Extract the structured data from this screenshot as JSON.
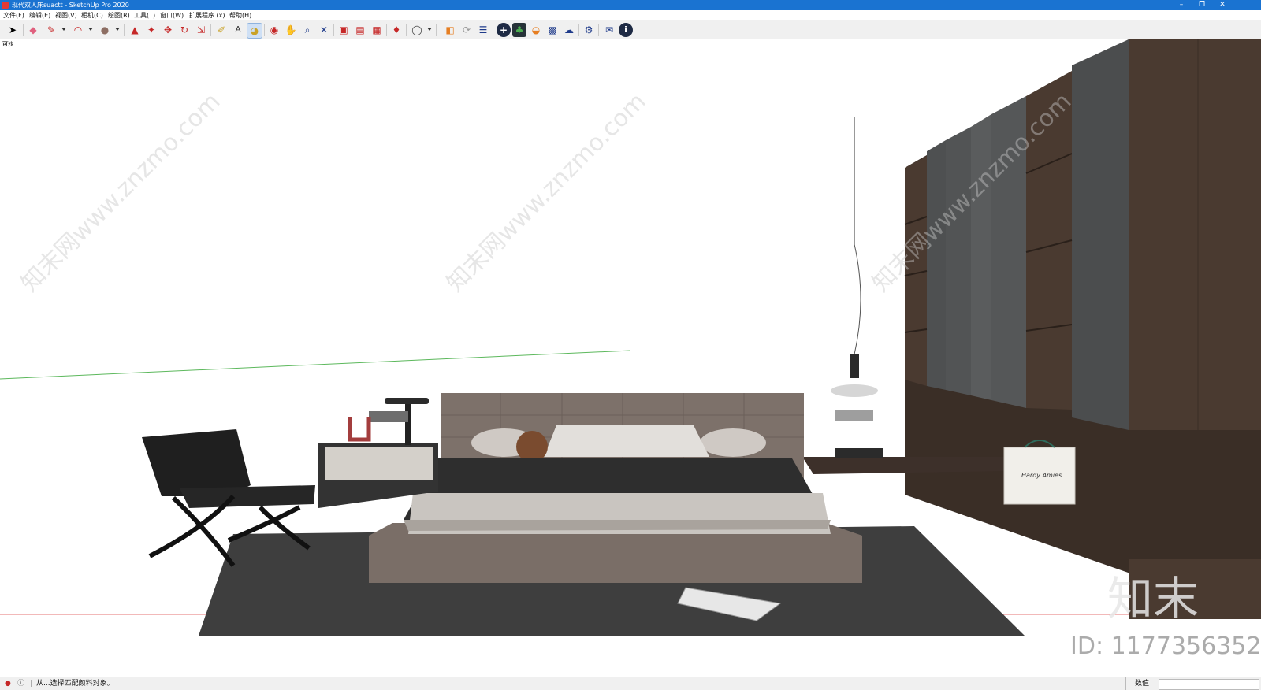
{
  "window": {
    "title": "现代双人床suactt - SketchUp Pro 2020",
    "controls": [
      "–",
      "❐",
      "✕"
    ]
  },
  "menu": [
    "文件(F)",
    "编辑(E)",
    "视图(V)",
    "相机(C)",
    "绘图(R)",
    "工具(T)",
    "窗口(W)",
    "扩展程序 (x)",
    "帮助(H)"
  ],
  "toolbar": {
    "tools": [
      {
        "name": "select-tool-icon",
        "glyph": "➤",
        "color": "#111"
      },
      {
        "name": "eraser-tool-icon",
        "glyph": "◆",
        "color": "#e0607e"
      },
      {
        "name": "line-tool-icon",
        "glyph": "✎",
        "color": "#c62828"
      },
      {
        "name": "arc-tool-icon",
        "glyph": "◠",
        "color": "#c62828"
      },
      {
        "name": "shapes-tool-icon",
        "glyph": "●",
        "color": "#8d6e63"
      },
      {
        "name": "push-pull-icon",
        "glyph": "▲",
        "color": "#c62828"
      },
      {
        "name": "follow-me-icon",
        "glyph": "✦",
        "color": "#c62828"
      },
      {
        "name": "move-tool-icon",
        "glyph": "✥",
        "color": "#c62828"
      },
      {
        "name": "rotate-tool-icon",
        "glyph": "↻",
        "color": "#c62828"
      },
      {
        "name": "scale-tool-icon",
        "glyph": "⇲",
        "color": "#c62828"
      },
      {
        "name": "tape-measure-icon",
        "glyph": "✐",
        "color": "#c9a227"
      },
      {
        "name": "text-tool-icon",
        "glyph": "A",
        "color": "#333"
      },
      {
        "name": "paint-bucket-icon",
        "glyph": "◕",
        "color": "#c9a227"
      },
      {
        "name": "orbit-tool-icon",
        "glyph": "◉",
        "color": "#c62828"
      },
      {
        "name": "pan-tool-icon",
        "glyph": "✋",
        "color": "#c9a227"
      },
      {
        "name": "zoom-tool-icon",
        "glyph": "⌕",
        "color": "#1e3a8a"
      },
      {
        "name": "zoom-extents-icon",
        "glyph": "✕",
        "color": "#1e3a8a"
      },
      {
        "name": "warehouse-icon",
        "glyph": "▣",
        "color": "#c62828"
      },
      {
        "name": "share-model-icon",
        "glyph": "▤",
        "color": "#c62828"
      },
      {
        "name": "extension-warehouse-icon",
        "glyph": "▦",
        "color": "#c62828"
      },
      {
        "name": "ruby-icon",
        "glyph": "♦",
        "color": "#c62828"
      },
      {
        "name": "user-account-icon",
        "glyph": "◯",
        "color": "#444"
      },
      {
        "name": "render-icon",
        "glyph": "◧",
        "color": "#e67e22"
      },
      {
        "name": "sync-icon",
        "glyph": "⟳",
        "color": "#999"
      },
      {
        "name": "layers-icon",
        "glyph": "☰",
        "color": "#1e3a8a"
      },
      {
        "name": "add-icon",
        "glyph": "+",
        "color": "#ffffff"
      },
      {
        "name": "tree-icon",
        "glyph": "♣",
        "color": "#2e7d32"
      },
      {
        "name": "sunset-icon",
        "glyph": "◒",
        "color": "#e67e22"
      },
      {
        "name": "checker-icon",
        "glyph": "▩",
        "color": "#1e3a8a"
      },
      {
        "name": "cloud-icon",
        "glyph": "☁",
        "color": "#1e3a8a"
      },
      {
        "name": "settings-icon",
        "glyph": "⚙",
        "color": "#1e3a8a"
      },
      {
        "name": "mail-icon",
        "glyph": "✉",
        "color": "#1e3a8a"
      },
      {
        "name": "info-icon",
        "glyph": "i",
        "color": "#ffffff"
      }
    ]
  },
  "viewport": {
    "scene_tag": "可沙",
    "watermark": "知末网www.znzmo.com",
    "logo_text": "知末",
    "id_text": "ID: 1177356352",
    "bag_brand": "Hardy Amies"
  },
  "status": {
    "message": "从...选择匹配颜料对象。",
    "value_label": "数值",
    "value": ""
  }
}
